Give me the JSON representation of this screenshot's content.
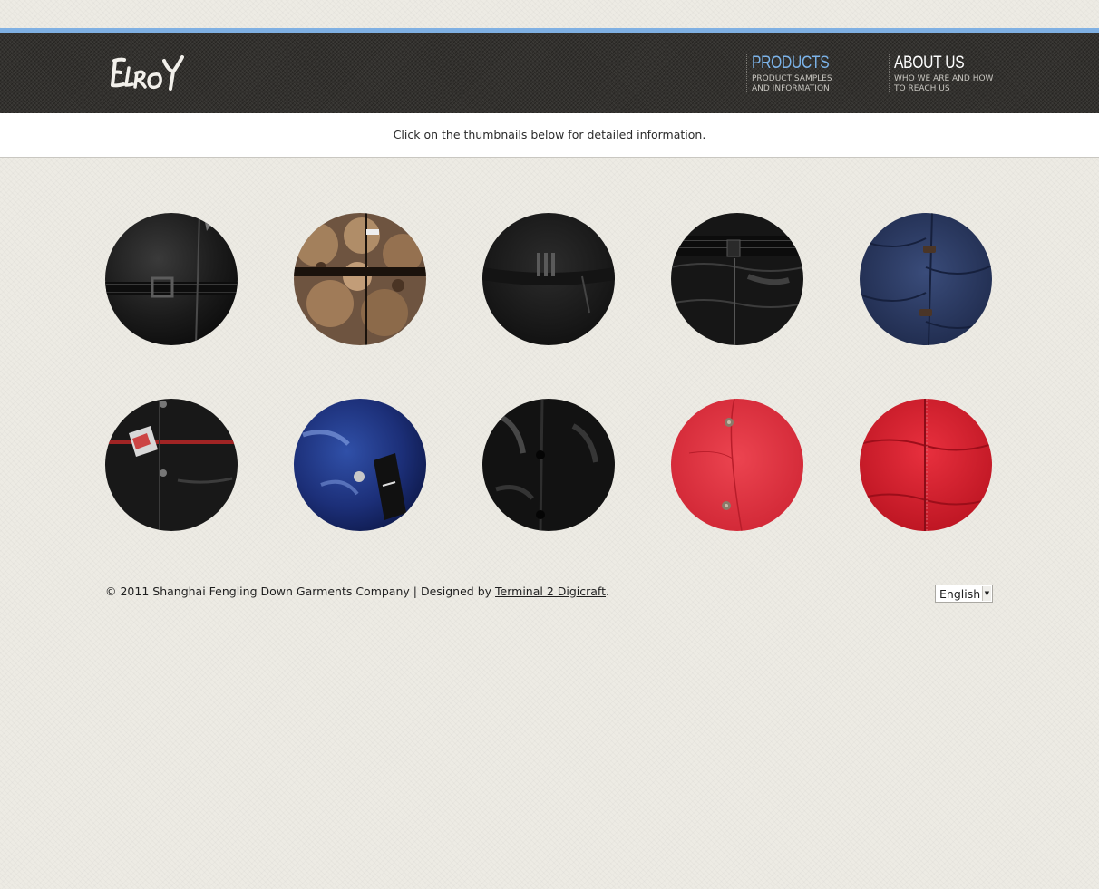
{
  "header": {
    "logo_text": "ELROY",
    "nav": [
      {
        "title": "PRODUCTS",
        "subtitle": "PRODUCT SAMPLES\nAND INFORMATION",
        "active": true,
        "color": "#7cb4ea"
      },
      {
        "title": "ABOUT US",
        "subtitle": "WHO WE ARE AND HOW\nTO REACH US",
        "active": false,
        "color": "#ffffff"
      }
    ]
  },
  "info_text": "Click on the thumbnails below for detailed information.",
  "thumbnails": [
    {
      "icon": "black-belted-jacket-thumbnail",
      "color": "#1b1b1b"
    },
    {
      "icon": "floral-print-jacket-thumbnail",
      "color": "#8a6a4f"
    },
    {
      "icon": "black-jacket-waist-thumbnail",
      "color": "#1d1d1d"
    },
    {
      "icon": "black-quilted-jacket-thumbnail",
      "color": "#151515"
    },
    {
      "icon": "navy-buttoned-jacket-thumbnail",
      "color": "#25355c"
    },
    {
      "icon": "black-tagged-jacket-thumbnail",
      "color": "#181818"
    },
    {
      "icon": "glossy-navy-jacket-thumbnail",
      "color": "#1a2a66"
    },
    {
      "icon": "glossy-black-jacket-thumbnail",
      "color": "#141414"
    },
    {
      "icon": "red-snap-jacket-thumbnail",
      "color": "#e0313e"
    },
    {
      "icon": "red-zip-jacket-thumbnail",
      "color": "#d81e30"
    }
  ],
  "footer": {
    "copyright": "© 2011 Shanghai Fengling Down Garments Company | Designed by ",
    "designer_link": "Terminal 2 Digicraft",
    "suffix": "."
  },
  "language_select": {
    "value": "English"
  },
  "colors": {
    "accent": "#7fb0e3",
    "header_bg": "#33312e"
  }
}
